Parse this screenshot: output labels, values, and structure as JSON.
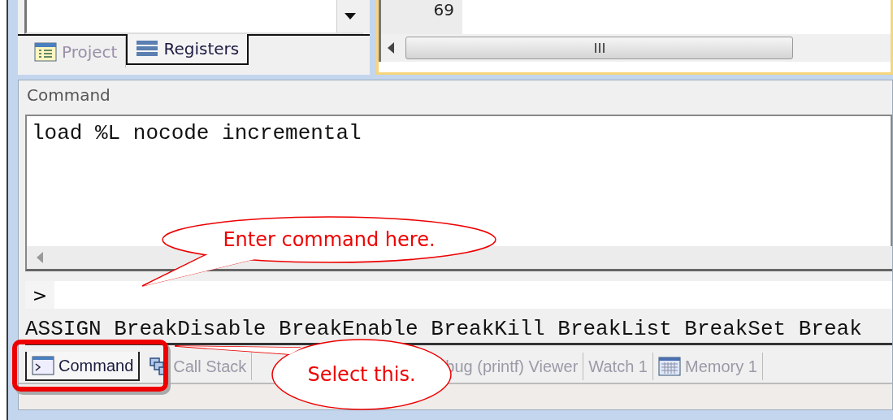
{
  "registers_panel": {
    "tabs": [
      {
        "label": "Project",
        "selected": false,
        "kind": "project"
      },
      {
        "label": "Registers",
        "selected": true,
        "kind": "registers"
      }
    ]
  },
  "editor": {
    "line_numbers": [
      "69"
    ]
  },
  "command_window": {
    "title": "Command",
    "output": [
      "load %L nocode incremental"
    ],
    "prompt": ">",
    "commands": "ASSIGN BreakDisable BreakEnable BreakKill BreakList BreakSet Break"
  },
  "bottom_tabs": [
    {
      "label": "Command",
      "selected": true,
      "kind": "command"
    },
    {
      "label": "Call Stack",
      "selected": false,
      "kind": "stack"
    },
    {
      "label": "bug (printf) Viewer",
      "selected": false,
      "kind": "plain"
    },
    {
      "label": "Watch 1",
      "selected": false,
      "kind": "plain"
    },
    {
      "label": "Memory 1",
      "selected": false,
      "kind": "memory"
    }
  ],
  "callouts": [
    {
      "text": "Enter command here.",
      "kind": "input"
    },
    {
      "text": "Select this.",
      "kind": "tab"
    }
  ]
}
